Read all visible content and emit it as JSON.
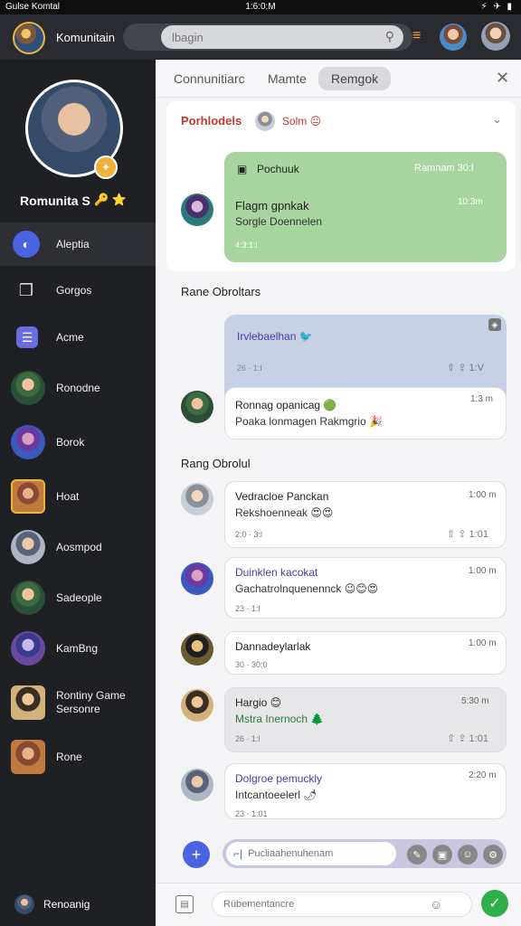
{
  "status": {
    "left": "Gulse Komtal",
    "center": "1:6:0:M",
    "right": "⚡ ✈ ▮"
  },
  "topbar": {
    "title": "Komunitain",
    "search_placeholder": "lbagin",
    "toggle_glyph": "≡"
  },
  "sidebar": {
    "profile_name": "Romunita S",
    "profile_badge": "🔑 ⭐",
    "items": [
      {
        "label": "Aleptia",
        "icon": "chat-bubble-icon"
      },
      {
        "label": "Gorgos",
        "icon": "box-icon"
      },
      {
        "label": "Acme",
        "icon": "list-icon"
      },
      {
        "label": "Ronodne",
        "icon": "avatar"
      },
      {
        "label": "Borok",
        "icon": "avatar"
      },
      {
        "label": "Hoat",
        "icon": "avatar"
      },
      {
        "label": "Aosmpod",
        "icon": "avatar"
      },
      {
        "label": "Sadeople",
        "icon": "avatar"
      },
      {
        "label": "KamBng",
        "icon": "avatar"
      },
      {
        "label": "Rontiny Game Sersonre",
        "icon": "avatar"
      },
      {
        "label": "Rone",
        "icon": "avatar"
      }
    ],
    "footer_label": "Renoanig"
  },
  "tabs": [
    {
      "label": "Connunitiarc"
    },
    {
      "label": "Mamte"
    },
    {
      "label": "Remgok"
    }
  ],
  "pinned": {
    "title": "Porhlodels",
    "user": "Solm 😐",
    "group_name": "Pochuuk",
    "group_meta": "Ramnam 30:l",
    "sender": "Flagm gpnkak",
    "sender_time": "10:3m",
    "sender_text": "Sorgle Doennelen",
    "sender_meta": "4:3:1:l"
  },
  "section1": {
    "label": "Rane Obroltars"
  },
  "highlight": {
    "title": "Irvlebaelhan 🐦",
    "meta": "26 · 1:l",
    "actions": "⇧ ⇪ 1:V"
  },
  "reply": {
    "name": "Ronnag opanicag 🟢",
    "time": "1:3 m",
    "text": "Poaka lonmagen Rakmgrio 🎉"
  },
  "section2": {
    "label": "Rang Obrolul"
  },
  "messages": [
    {
      "name": "Vedracloe Panckan",
      "time": "1:00 m",
      "text": "Rekshoenneak 😍😍",
      "meta": "2:0 · 3:l",
      "actions": "⇧ ⇪ 1:01"
    },
    {
      "name": "Duinklen kacokat",
      "time": "1:00 m",
      "text": "Gachatrolnquenennck 😉😊😍",
      "meta": "23 · 1:l",
      "actions": ""
    },
    {
      "name": "Dannadeylarlak",
      "time": "1:00 m",
      "text": "",
      "meta": "30 · 30:0",
      "actions": ""
    },
    {
      "name": "Hargio 😊",
      "time": "5:30 m",
      "text": "Mstra Inernoch 🌲",
      "meta": "26 · 1:l",
      "actions": "⇧ ⇪ 1:01"
    },
    {
      "name": "Dolgroe pemuckly",
      "time": "2:20 m",
      "text": "Intcantoeelerl 🌶",
      "meta": "23 · 1:01",
      "actions": ""
    }
  ],
  "composer": {
    "placeholder": "Pucliaahenuhenam",
    "caret": "⌐|"
  },
  "bottom": {
    "placeholder": "Rübementancre"
  },
  "colors": {
    "accent": "#4a63e0",
    "green_bubble": "#a8d59f",
    "blue_bubble": "#c6d1e5",
    "send": "#2fae4a"
  }
}
